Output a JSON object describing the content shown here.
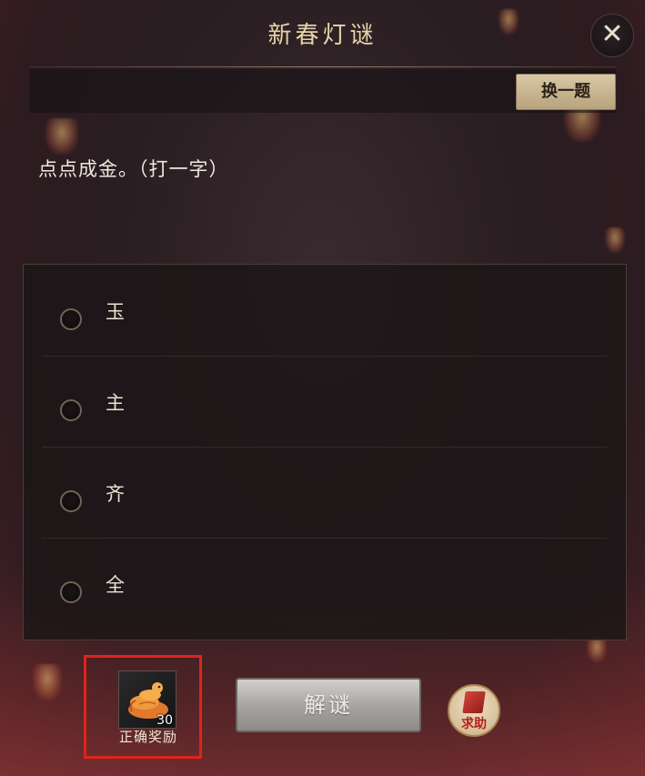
{
  "dialog": {
    "title": "新春灯谜",
    "close_label": "✕",
    "change_label": "换一题"
  },
  "question": {
    "text": "点点成金。（打一字）"
  },
  "options": [
    {
      "label": "玉"
    },
    {
      "label": "主"
    },
    {
      "label": "齐"
    },
    {
      "label": "全"
    }
  ],
  "reward": {
    "label": "正确奖励",
    "count": "30",
    "icon": "golden-snake-icon"
  },
  "actions": {
    "solve_label": "解谜",
    "help_label": "求助"
  },
  "colors": {
    "title_gold": "#e6d3a8",
    "highlight_red": "#e0231b"
  }
}
